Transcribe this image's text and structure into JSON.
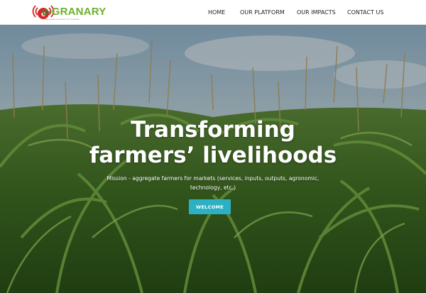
{
  "brand": {
    "logo_dash": "e-",
    "logo_name": "GRANARY",
    "tagline": "aggregating farmers for markets"
  },
  "nav": {
    "items": [
      {
        "label": "HOME"
      },
      {
        "label": "OUR PLATFORM"
      },
      {
        "label": "OUR IMPACTS"
      },
      {
        "label": "CONTACT US"
      }
    ]
  },
  "hero": {
    "title_line1": "Transforming",
    "title_line2": "farmers’ livelihoods",
    "subtitle": "Mission - aggregate farmers for markets (services, inputs, outputs, agronomic, technology, etc.)",
    "button_label": "WELCOME"
  },
  "colors": {
    "accent": "#2cb1c4",
    "logo_red": "#d8262b",
    "logo_green": "#6fae2f"
  }
}
